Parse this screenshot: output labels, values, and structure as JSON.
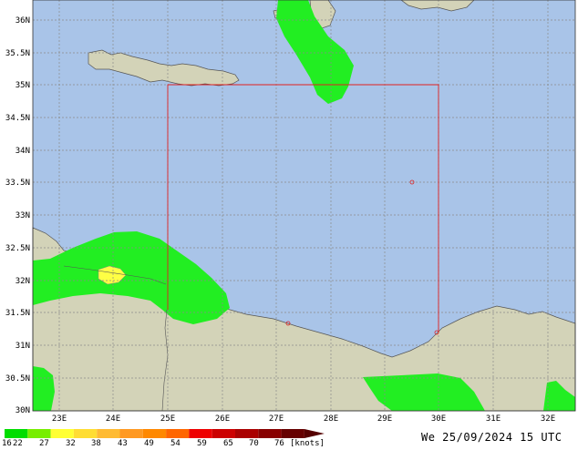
{
  "map": {
    "lat_ticks": [
      "36N",
      "35.5N",
      "35N",
      "34.5N",
      "34N",
      "33.5N",
      "33N",
      "32.5N",
      "32N",
      "31.5N",
      "31N",
      "30.5N",
      "30N"
    ],
    "lon_ticks": [
      "23E",
      "24E",
      "25E",
      "26E",
      "27E",
      "28E",
      "29E",
      "30E",
      "31E",
      "32E"
    ],
    "colors": {
      "sea": "#a9c4e8",
      "land": "#d3d3b8",
      "wind_low": "#22ee22",
      "wind_mid": "#ffff44",
      "domain_box": "#e02020"
    }
  },
  "legend": {
    "values": [
      "16",
      "22",
      "27",
      "32",
      "38",
      "43",
      "49",
      "54",
      "59",
      "65",
      "70",
      "76"
    ],
    "unit": "[knots]",
    "colors": [
      "#00dd00",
      "#77ee00",
      "#ffff33",
      "#ffdd33",
      "#ffbb33",
      "#ff9922",
      "#ff8800",
      "#ff6600",
      "#ee0000",
      "#cc0000",
      "#aa0000",
      "#880000",
      "#660000"
    ]
  },
  "timestamp": "We 25/09/2024 15 UTC"
}
